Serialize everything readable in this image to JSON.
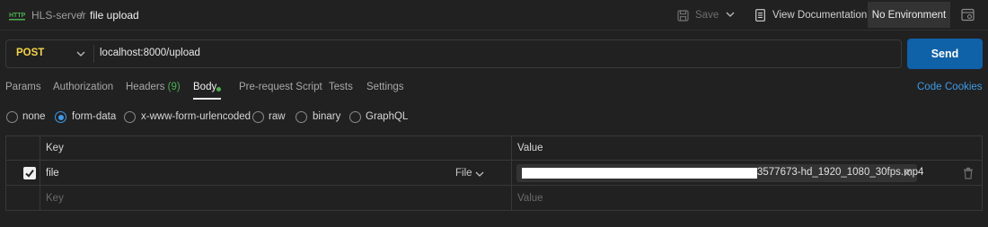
{
  "header": {
    "breadcrumb_parent": "HLS-server",
    "breadcrumb_separator": "/",
    "breadcrumb_current": "file upload",
    "save_label": "Save",
    "view_documentation_label": "View Documentation",
    "environment_label": "No Environment"
  },
  "request": {
    "method": "POST",
    "url": "localhost:8000/upload",
    "send_label": "Send"
  },
  "tabs": {
    "params": "Params",
    "authorization": "Authorization",
    "headers": "Headers",
    "headers_count": "(9)",
    "body": "Body",
    "pre_request_script": "Pre-request Script",
    "tests": "Tests",
    "settings": "Settings",
    "code_link": "Code",
    "cookies_link": "Cookies"
  },
  "body_types": {
    "none": "none",
    "form_data": "form-data",
    "urlencoded": "x-www-form-urlencoded",
    "raw": "raw",
    "binary": "binary",
    "graphql": "GraphQL",
    "selected": "form-data"
  },
  "form_table": {
    "columns": {
      "key": "Key",
      "value": "Value"
    },
    "rows": [
      {
        "key": "file",
        "type": "File",
        "value": "3577673-hd_1920_1080_30fps.mp4",
        "checked": true
      }
    ],
    "new_row": {
      "key_placeholder": "Key",
      "value_placeholder": "Value"
    }
  },
  "colors": {
    "background": "#212121",
    "accent_blue": "#0f61a8",
    "method_yellow": "#f5d547",
    "status_green": "#4caf50"
  },
  "icons": [
    "http-icon",
    "save-icon",
    "chevron-down-icon",
    "documentation-icon",
    "environment-settings-icon",
    "close-icon",
    "trash-icon",
    "check-icon"
  ]
}
